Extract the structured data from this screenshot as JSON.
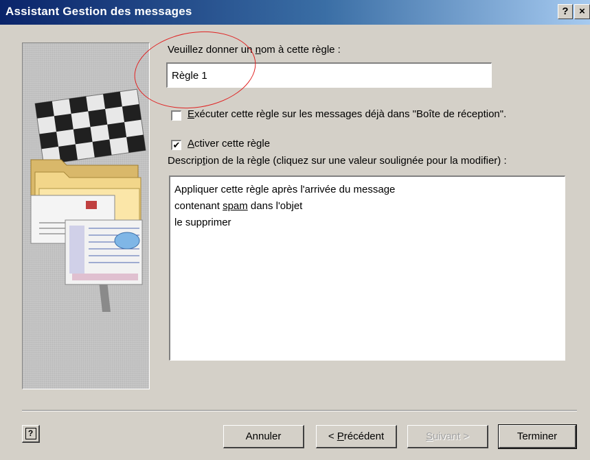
{
  "window": {
    "title": "Assistant Gestion des messages",
    "help_glyph": "?",
    "close_glyph": "×"
  },
  "form": {
    "name_label": {
      "pre": "Veuillez donner un ",
      "accel": "n",
      "post": "om à cette règle :"
    },
    "name_value": "Règle 1",
    "run_existing": {
      "checked": false,
      "accel": "E",
      "label_rest": "xécuter cette règle sur les messages déjà dans \"Boîte de réception\"."
    },
    "activate": {
      "checked": true,
      "accel": "A",
      "label_rest": "ctiver cette règle"
    },
    "desc_label": {
      "pre": "Descrip",
      "accel": "t",
      "post": "ion de la règle (cliquez sur une valeur soulignée pour la modifier) :"
    }
  },
  "description": {
    "line1": "Appliquer cette règle après l'arrivée du message",
    "line2_pre": "contenant ",
    "line2_link": "spam",
    "line2_post": " dans l'objet",
    "line3": "le supprimer"
  },
  "buttons": {
    "cancel": "Annuler",
    "prev_pre": "< ",
    "prev_accel": "P",
    "prev_rest": "récédent",
    "next_accel": "S",
    "next_rest": "uivant >",
    "finish": "Terminer"
  },
  "annotation": {
    "color": "#e02020"
  },
  "colors": {
    "dialog_bg": "#d4d0c8",
    "title_start": "#0a246a",
    "title_end": "#a6caf0"
  }
}
